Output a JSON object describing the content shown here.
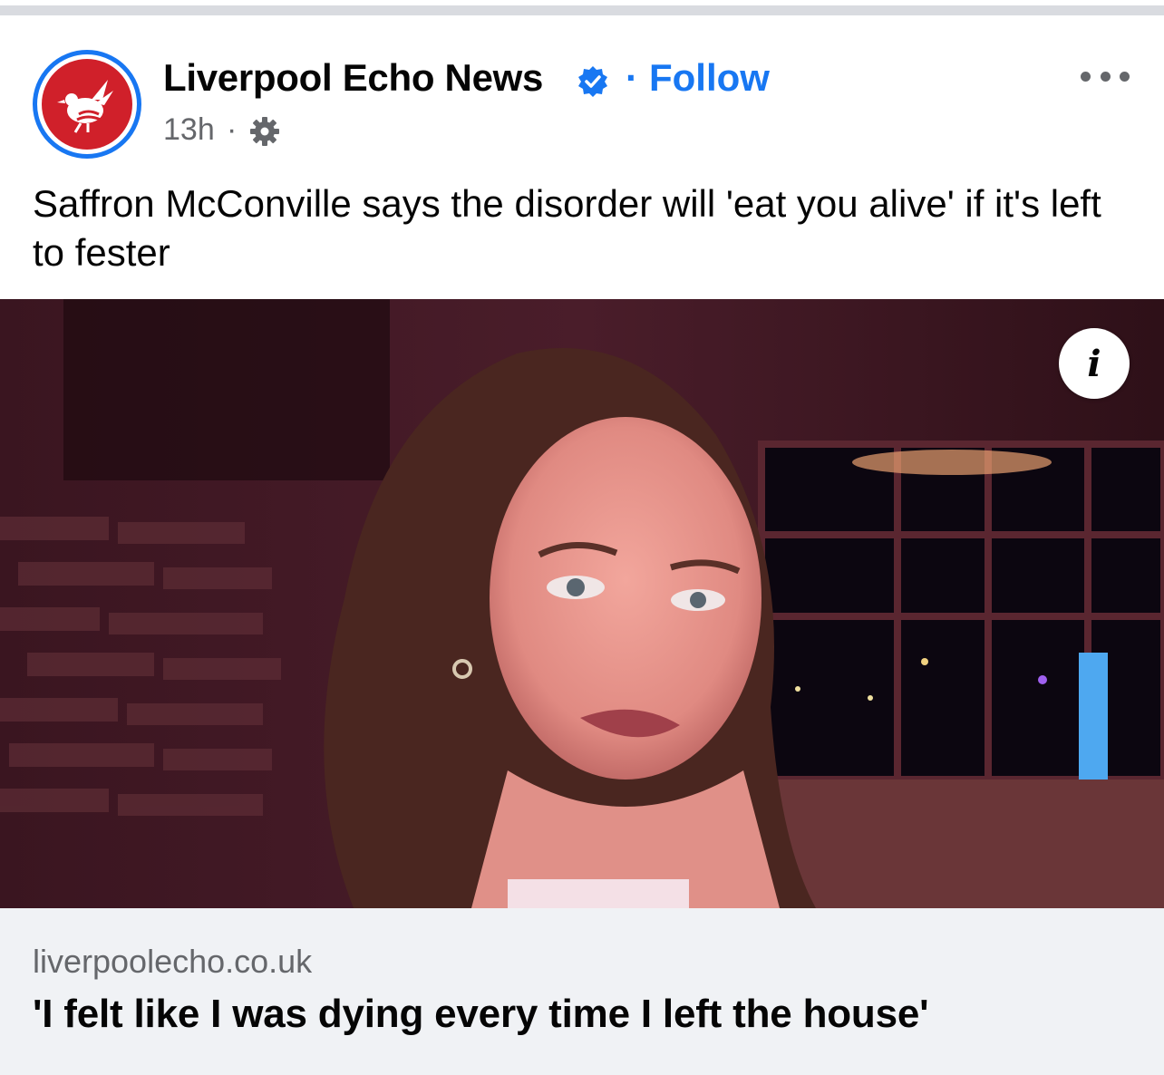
{
  "post": {
    "page_name": "Liverpool Echo News",
    "verified_icon": "verified-badge-icon",
    "separator": "·",
    "follow_label": "Follow",
    "timestamp": "13h",
    "meta_separator": "·",
    "audience_icon": "gear-icon",
    "more_icon": "more-options-icon",
    "caption": "Saffron McConville says the disorder will 'eat you alive' if it's left to fester"
  },
  "link_preview": {
    "info_icon": "info-icon",
    "info_glyph": "i",
    "domain": "liverpoolecho.co.uk",
    "headline": "'I felt like I was dying every time I left the house'"
  },
  "colors": {
    "accent": "#1877f2",
    "avatar_red": "#d0202a",
    "secondary_text": "#65676b",
    "link_box_bg": "#f0f2f5"
  }
}
